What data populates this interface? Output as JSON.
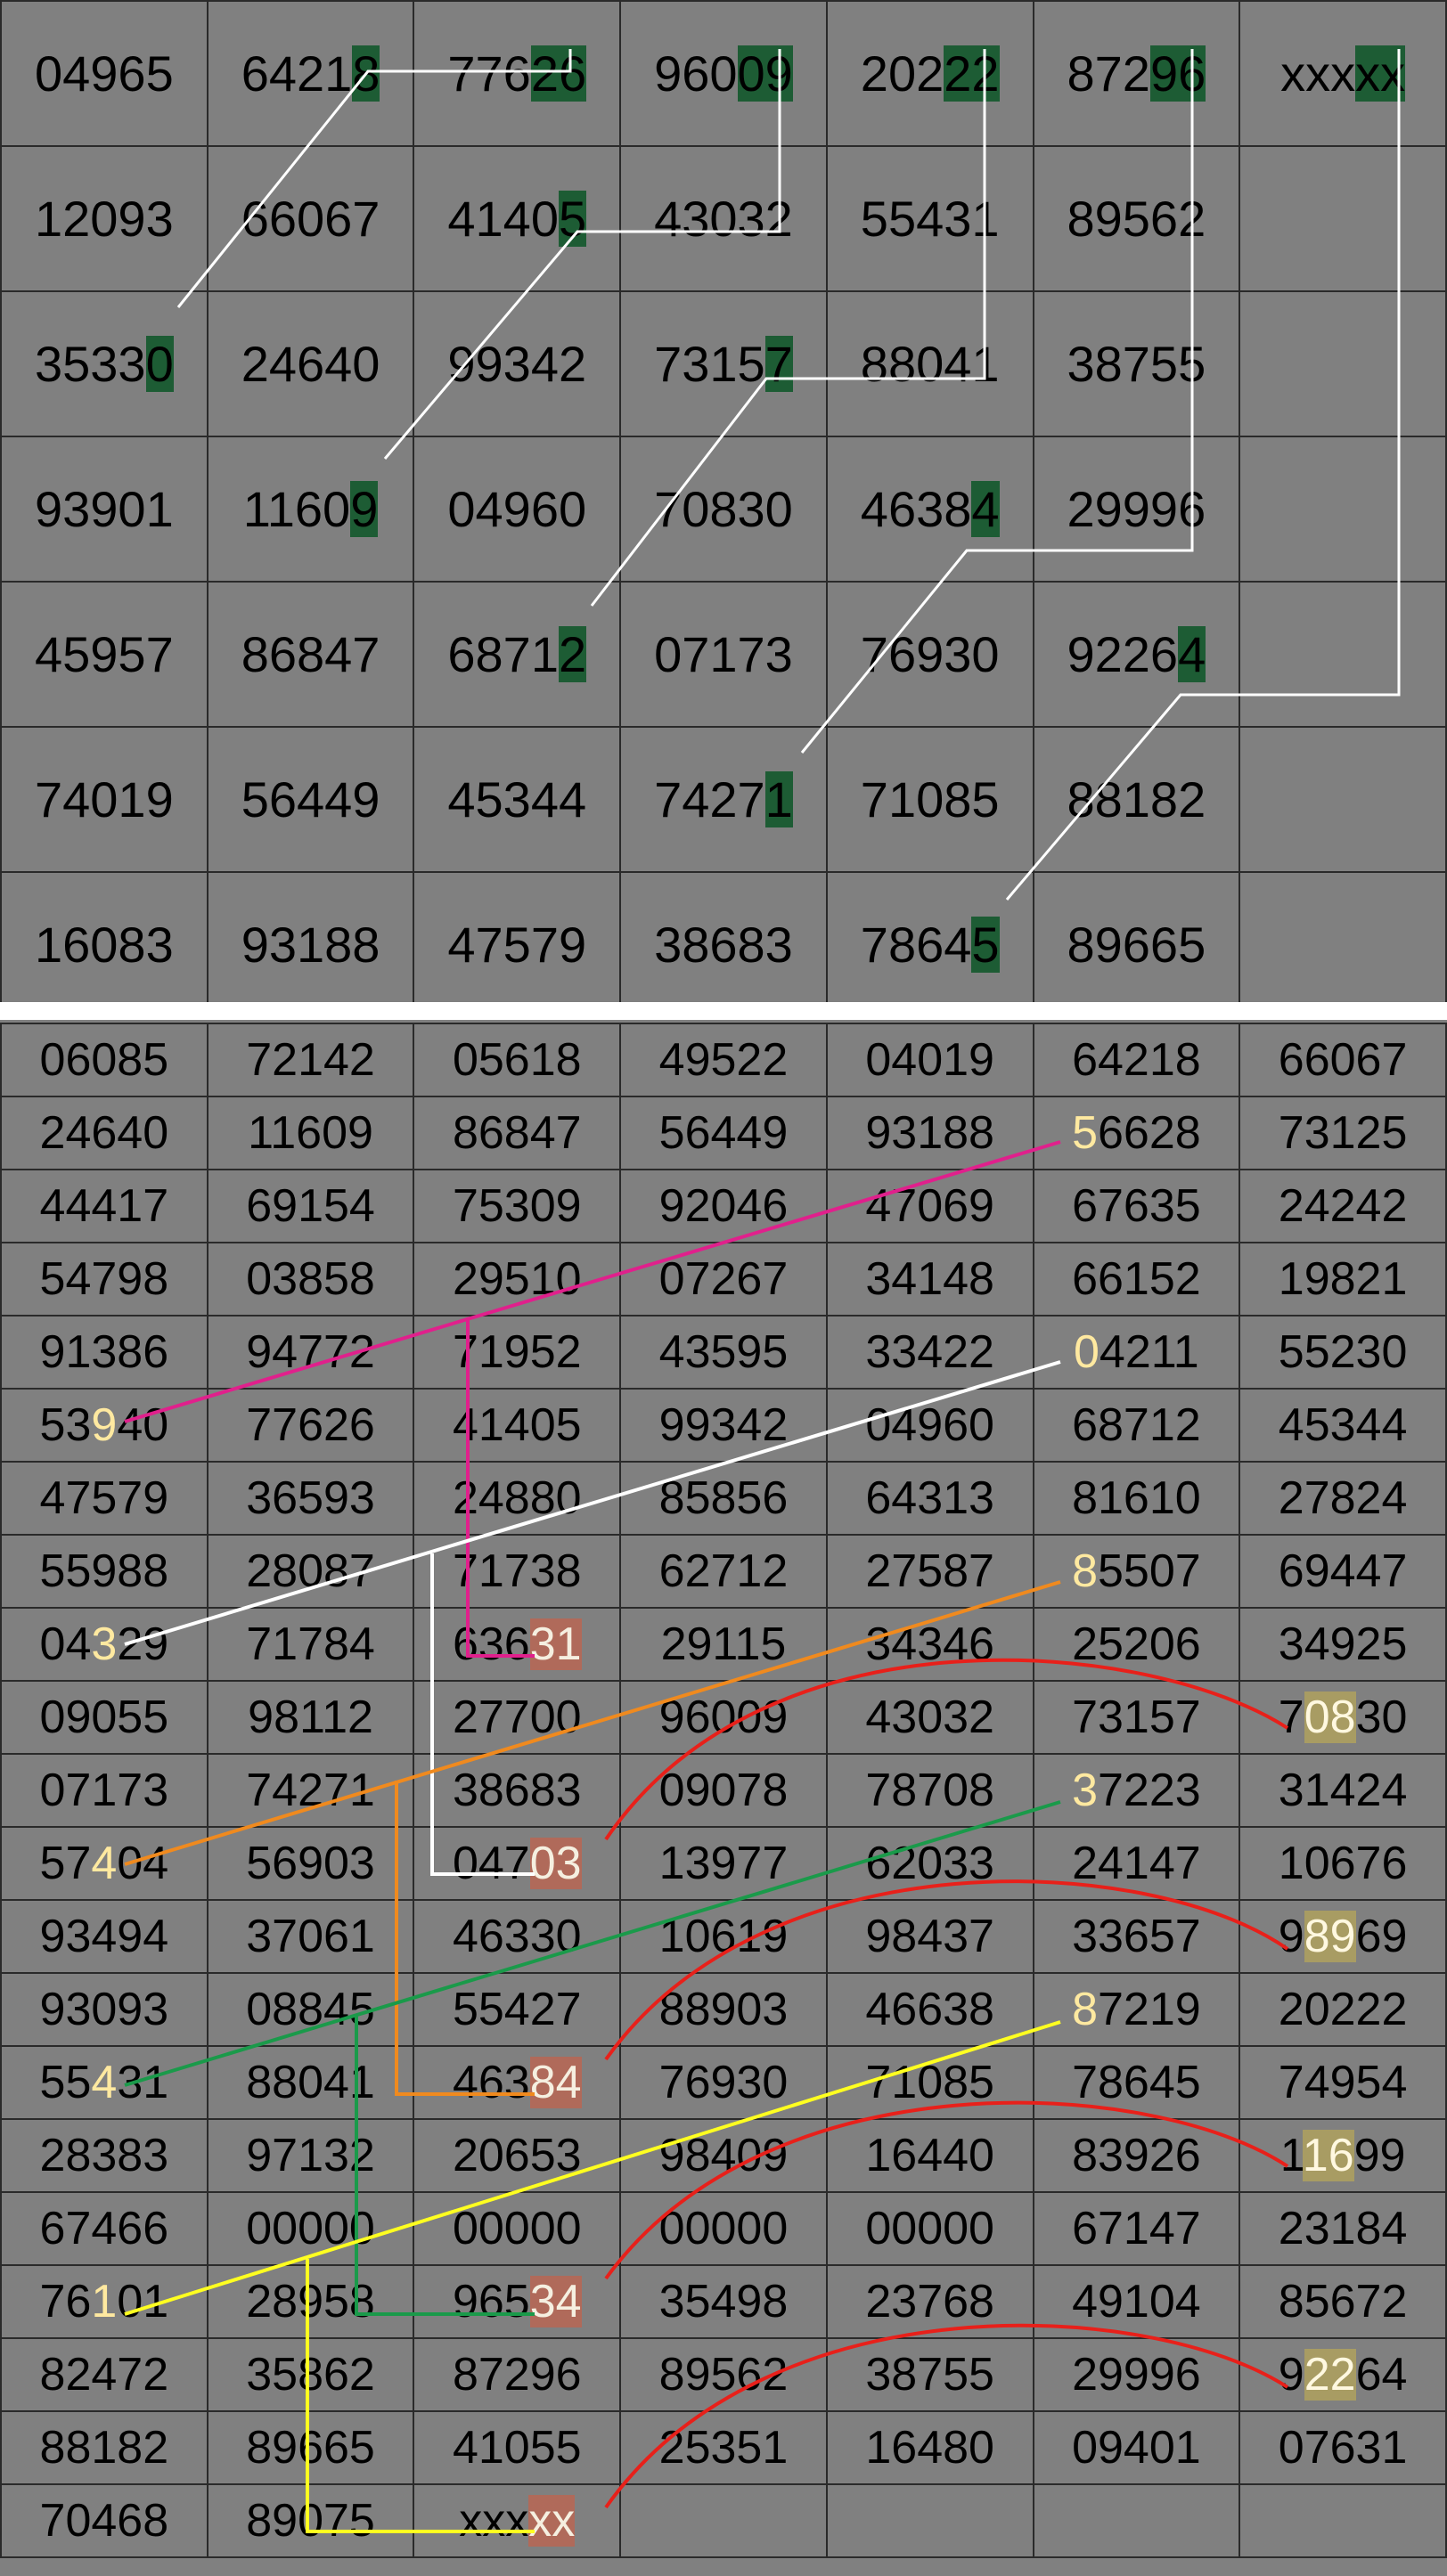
{
  "top_grid": [
    [
      "04965",
      "64218",
      "77626",
      "96009",
      "20222",
      "87296",
      "xxxxx"
    ],
    [
      "12093",
      "66067",
      "41405",
      "43032",
      "55431",
      "89562",
      ""
    ],
    [
      "35330",
      "24640",
      "99342",
      "73157",
      "88041",
      "38755",
      ""
    ],
    [
      "93901",
      "11609",
      "04960",
      "70830",
      "46384",
      "29996",
      ""
    ],
    [
      "45957",
      "86847",
      "68712",
      "07173",
      "76930",
      "92264",
      ""
    ],
    [
      "74019",
      "56449",
      "45344",
      "74271",
      "71085",
      "88182",
      ""
    ],
    [
      "16083",
      "93188",
      "47579",
      "38683",
      "78645",
      "89665",
      ""
    ]
  ],
  "top_highlights": [
    {
      "row": 0,
      "col": 1,
      "start": 4,
      "len": 1
    },
    {
      "row": 0,
      "col": 2,
      "start": 3,
      "len": 2
    },
    {
      "row": 0,
      "col": 3,
      "start": 3,
      "len": 2
    },
    {
      "row": 0,
      "col": 4,
      "start": 3,
      "len": 2
    },
    {
      "row": 0,
      "col": 5,
      "start": 3,
      "len": 2
    },
    {
      "row": 0,
      "col": 6,
      "start": 3,
      "len": 2
    },
    {
      "row": 1,
      "col": 2,
      "start": 4,
      "len": 1
    },
    {
      "row": 2,
      "col": 0,
      "start": 4,
      "len": 1
    },
    {
      "row": 2,
      "col": 3,
      "start": 4,
      "len": 1
    },
    {
      "row": 3,
      "col": 1,
      "start": 4,
      "len": 1
    },
    {
      "row": 3,
      "col": 4,
      "start": 4,
      "len": 1
    },
    {
      "row": 4,
      "col": 2,
      "start": 4,
      "len": 1
    },
    {
      "row": 4,
      "col": 5,
      "start": 4,
      "len": 1
    },
    {
      "row": 5,
      "col": 3,
      "start": 4,
      "len": 1
    },
    {
      "row": 6,
      "col": 4,
      "start": 4,
      "len": 1
    }
  ],
  "bottom_grid": [
    [
      "06085",
      "72142",
      "05618",
      "49522",
      "04019",
      "64218",
      "66067"
    ],
    [
      "24640",
      "11609",
      "86847",
      "56449",
      "93188",
      "56628",
      "73125"
    ],
    [
      "44417",
      "69154",
      "75309",
      "92046",
      "47069",
      "67635",
      "24242"
    ],
    [
      "54798",
      "03858",
      "29510",
      "07267",
      "34148",
      "66152",
      "19821"
    ],
    [
      "91386",
      "94772",
      "71952",
      "43595",
      "33422",
      "04211",
      "55230"
    ],
    [
      "53940",
      "77626",
      "41405",
      "99342",
      "04960",
      "68712",
      "45344"
    ],
    [
      "47579",
      "36593",
      "24880",
      "85856",
      "64313",
      "81610",
      "27824"
    ],
    [
      "55988",
      "28087",
      "71738",
      "62712",
      "27587",
      "85507",
      "69447"
    ],
    [
      "04329",
      "71784",
      "63631",
      "29115",
      "34346",
      "25206",
      "34925"
    ],
    [
      "09055",
      "98112",
      "27700",
      "96009",
      "43032",
      "73157",
      "70830"
    ],
    [
      "07173",
      "74271",
      "38683",
      "09078",
      "78708",
      "37223",
      "31424"
    ],
    [
      "57404",
      "56903",
      "04703",
      "13977",
      "62033",
      "24147",
      "10676"
    ],
    [
      "93494",
      "37061",
      "46330",
      "10619",
      "98437",
      "33657",
      "98969"
    ],
    [
      "93093",
      "08845",
      "55427",
      "88903",
      "46638",
      "87219",
      "20222"
    ],
    [
      "55431",
      "88041",
      "46384",
      "76930",
      "71085",
      "78645",
      "74954"
    ],
    [
      "28383",
      "97132",
      "20653",
      "98409",
      "16440",
      "83926",
      "11699"
    ],
    [
      "67466",
      "00000",
      "00000",
      "00000",
      "00000",
      "67147",
      "23184"
    ],
    [
      "76101",
      "28958",
      "96534",
      "35498",
      "23768",
      "49104",
      "85672"
    ],
    [
      "82472",
      "35862",
      "87296",
      "89562",
      "38755",
      "29996",
      "92264"
    ],
    [
      "88182",
      "89665",
      "41055",
      "25351",
      "16480",
      "09401",
      "07631"
    ],
    [
      "70468",
      "89075",
      "xxxxx",
      "",
      "",
      "",
      ""
    ]
  ],
  "bottom_highlights": [
    {
      "row": 1,
      "col": 5,
      "start": 0,
      "len": 1,
      "style": "ytxt"
    },
    {
      "row": 4,
      "col": 5,
      "start": 0,
      "len": 1,
      "style": "ytxt"
    },
    {
      "row": 5,
      "col": 0,
      "start": 2,
      "len": 1,
      "style": "ytxt"
    },
    {
      "row": 7,
      "col": 5,
      "start": 0,
      "len": 1,
      "style": "ytxt"
    },
    {
      "row": 8,
      "col": 0,
      "start": 2,
      "len": 1,
      "style": "ytxt"
    },
    {
      "row": 8,
      "col": 2,
      "start": 3,
      "len": 2,
      "style": "red"
    },
    {
      "row": 9,
      "col": 6,
      "start": 1,
      "len": 2,
      "style": "gold"
    },
    {
      "row": 10,
      "col": 5,
      "start": 0,
      "len": 1,
      "style": "ytxt"
    },
    {
      "row": 11,
      "col": 0,
      "start": 2,
      "len": 1,
      "style": "ytxt"
    },
    {
      "row": 11,
      "col": 2,
      "start": 3,
      "len": 2,
      "style": "red"
    },
    {
      "row": 12,
      "col": 6,
      "start": 1,
      "len": 2,
      "style": "gold"
    },
    {
      "row": 13,
      "col": 5,
      "start": 0,
      "len": 1,
      "style": "ytxt"
    },
    {
      "row": 14,
      "col": 0,
      "start": 2,
      "len": 1,
      "style": "ytxt"
    },
    {
      "row": 14,
      "col": 2,
      "start": 3,
      "len": 2,
      "style": "red"
    },
    {
      "row": 15,
      "col": 6,
      "start": 1,
      "len": 2,
      "style": "gold"
    },
    {
      "row": 17,
      "col": 0,
      "start": 2,
      "len": 1,
      "style": "ytxt"
    },
    {
      "row": 17,
      "col": 2,
      "start": 3,
      "len": 2,
      "style": "red"
    },
    {
      "row": 18,
      "col": 6,
      "start": 1,
      "len": 2,
      "style": "gold"
    },
    {
      "row": 20,
      "col": 2,
      "start": 3,
      "len": 2,
      "style": "red"
    }
  ],
  "colors": {
    "background": "#808080",
    "grid_line": "#2a2a2a",
    "highlight_green": "#1d5c34",
    "highlight_red": "#b06a5a",
    "highlight_gold": "#a89c63",
    "line_white": "#ffffff",
    "line_magenta": "#e0208c",
    "line_orange": "#f08a1e",
    "line_green": "#1a9a4a",
    "line_yellow": "#ffff20",
    "line_red": "#e8201a"
  }
}
